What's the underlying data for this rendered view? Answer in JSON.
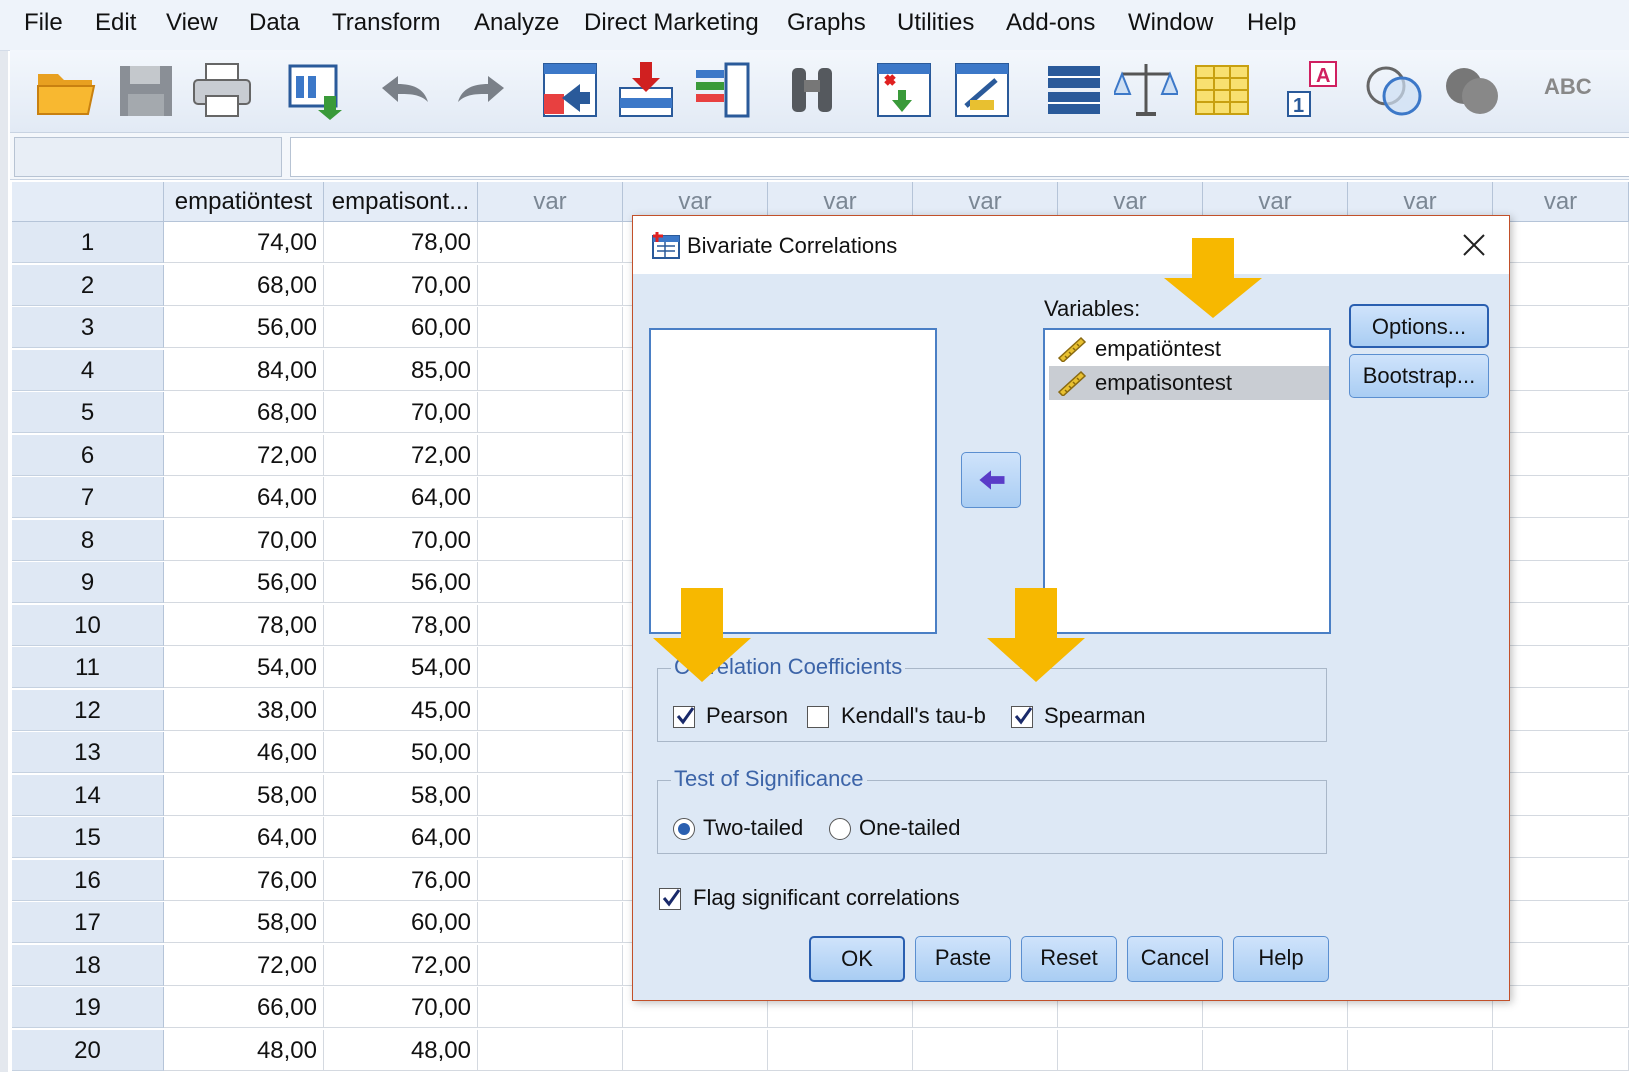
{
  "menubar": {
    "items": [
      "File",
      "Edit",
      "View",
      "Data",
      "Transform",
      "Analyze",
      "Direct Marketing",
      "Graphs",
      "Utilities",
      "Add-ons",
      "Window",
      "Help"
    ]
  },
  "toolbar": {
    "icons": [
      "open-folder-icon",
      "save-icon",
      "print-icon",
      "recall-dialog-icon",
      "undo-icon",
      "redo-icon",
      "goto-case-icon",
      "goto-variable-icon",
      "variables-icon",
      "find-icon",
      "insert-cases-icon",
      "insert-variable-icon",
      "split-file-icon",
      "weight-cases-icon",
      "select-cases-icon",
      "value-labels-icon",
      "use-sets-icon",
      "show-sets-icon",
      "spelling-icon"
    ],
    "overflow_label": "ABC"
  },
  "grid": {
    "columns": [
      "empatiöntest",
      "empatisont...",
      "var",
      "var",
      "var",
      "var",
      "var",
      "var",
      "var",
      "var"
    ],
    "rows": [
      [
        "1",
        "74,00",
        "78,00"
      ],
      [
        "2",
        "68,00",
        "70,00"
      ],
      [
        "3",
        "56,00",
        "60,00"
      ],
      [
        "4",
        "84,00",
        "85,00"
      ],
      [
        "5",
        "68,00",
        "70,00"
      ],
      [
        "6",
        "72,00",
        "72,00"
      ],
      [
        "7",
        "64,00",
        "64,00"
      ],
      [
        "8",
        "70,00",
        "70,00"
      ],
      [
        "9",
        "56,00",
        "56,00"
      ],
      [
        "10",
        "78,00",
        "78,00"
      ],
      [
        "11",
        "54,00",
        "54,00"
      ],
      [
        "12",
        "38,00",
        "45,00"
      ],
      [
        "13",
        "46,00",
        "50,00"
      ],
      [
        "14",
        "58,00",
        "58,00"
      ],
      [
        "15",
        "64,00",
        "64,00"
      ],
      [
        "16",
        "76,00",
        "76,00"
      ],
      [
        "17",
        "58,00",
        "60,00"
      ],
      [
        "18",
        "72,00",
        "72,00"
      ],
      [
        "19",
        "66,00",
        "70,00"
      ],
      [
        "20",
        "48,00",
        "48,00"
      ]
    ]
  },
  "dialog": {
    "title": "Bivariate Correlations",
    "variables_label": "Variables:",
    "variables": [
      "empatiöntest",
      "empatisontest"
    ],
    "selected_variable": "empatisontest",
    "options_button": "Options...",
    "bootstrap_button": "Bootstrap...",
    "coefficients_group": "Correlation Coefficients",
    "pearson_label": "Pearson",
    "pearson_checked": true,
    "kendall_label": "Kendall's tau-b",
    "kendall_checked": false,
    "spearman_label": "Spearman",
    "spearman_checked": true,
    "significance_group": "Test of Significance",
    "two_tailed_label": "Two-tailed",
    "two_tailed_selected": true,
    "one_tailed_label": "One-tailed",
    "flag_label": "Flag significant correlations",
    "flag_checked": true,
    "buttons": {
      "ok": "OK",
      "paste": "Paste",
      "reset": "Reset",
      "cancel": "Cancel",
      "help": "Help"
    }
  },
  "colors": {
    "annotation_arrow": "#f7b800",
    "dialog_bg": "#dde8f5",
    "button_border": "#5b8fd0",
    "group_legend": "#3c64a8"
  }
}
